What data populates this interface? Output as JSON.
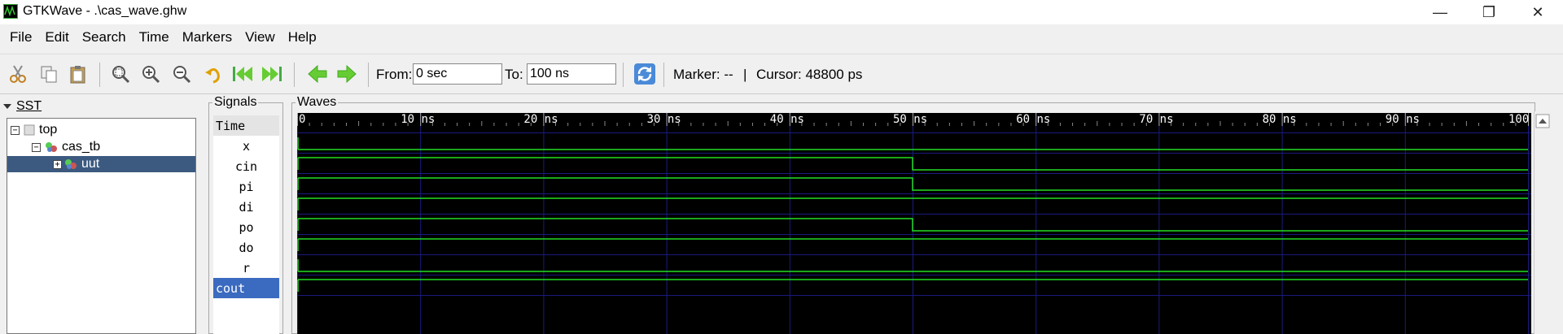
{
  "window": {
    "title": "GTKWave - .\\cas_wave.ghw",
    "minimize_glyph": "—",
    "maximize_glyph": "❐",
    "close_glyph": "✕"
  },
  "menu": [
    "File",
    "Edit",
    "Search",
    "Time",
    "Markers",
    "View",
    "Help"
  ],
  "toolbar": {
    "icons": [
      "cut-icon",
      "copy-icon",
      "paste-icon",
      "zoom-fit-icon",
      "zoom-in-icon",
      "zoom-out-icon",
      "undo-icon",
      "zoom-start-icon",
      "zoom-end-icon",
      "back-icon",
      "forward-icon",
      "reload-icon"
    ],
    "from_label": "From:",
    "from_value": "0 sec",
    "to_label": "To:",
    "to_value": "100 ns",
    "marker_text": "Marker: --",
    "divider": "|",
    "cursor_text": "Cursor: 48800 ps"
  },
  "sst": {
    "title": "SST",
    "tree": [
      {
        "label": "top",
        "level": 0,
        "expander": "−"
      },
      {
        "label": "cas_tb",
        "level": 1,
        "expander": "−"
      },
      {
        "label": "uut",
        "level": 2,
        "expander": "+",
        "selected": true
      }
    ]
  },
  "signals": {
    "title": "Signals",
    "header": "Time",
    "items": [
      "x",
      "cin",
      "pi",
      "di",
      "po",
      "do",
      "r",
      "cout"
    ],
    "selected_index": 7
  },
  "waves": {
    "title": "Waves",
    "unit": "ns",
    "time_range": [
      0,
      100
    ],
    "major_ticks": [
      0,
      10,
      20,
      30,
      40,
      50,
      60,
      70,
      80,
      90,
      100
    ],
    "tick_labels": [
      "0",
      "10 ns",
      "20 ns",
      "30 ns",
      "40 ns",
      "50 ns",
      "60 ns",
      "70 ns",
      "80 ns",
      "90 ns",
      "100 n"
    ],
    "grid": true,
    "signals": [
      {
        "name": "x",
        "segments": [
          [
            0,
            100,
            0
          ]
        ]
      },
      {
        "name": "cin",
        "segments": [
          [
            0,
            50,
            1
          ],
          [
            50,
            100,
            0
          ]
        ]
      },
      {
        "name": "pi",
        "segments": [
          [
            0,
            50,
            1
          ],
          [
            50,
            100,
            0
          ]
        ]
      },
      {
        "name": "di",
        "segments": [
          [
            0,
            100,
            1
          ]
        ]
      },
      {
        "name": "po",
        "segments": [
          [
            0,
            50,
            1
          ],
          [
            50,
            100,
            0
          ]
        ]
      },
      {
        "name": "do",
        "segments": [
          [
            0,
            100,
            1
          ]
        ]
      },
      {
        "name": "r",
        "segments": [
          [
            0,
            100,
            0
          ]
        ]
      },
      {
        "name": "cout",
        "segments": [
          [
            0,
            100,
            1
          ]
        ]
      }
    ],
    "colors": {
      "background": "#000000",
      "trace": "#22dd22",
      "grid": "#1a1a80",
      "tick_text": "#ffffff"
    }
  },
  "colors": {
    "selection": "#3c5a80",
    "signal_selection": "#3b6bc0"
  }
}
